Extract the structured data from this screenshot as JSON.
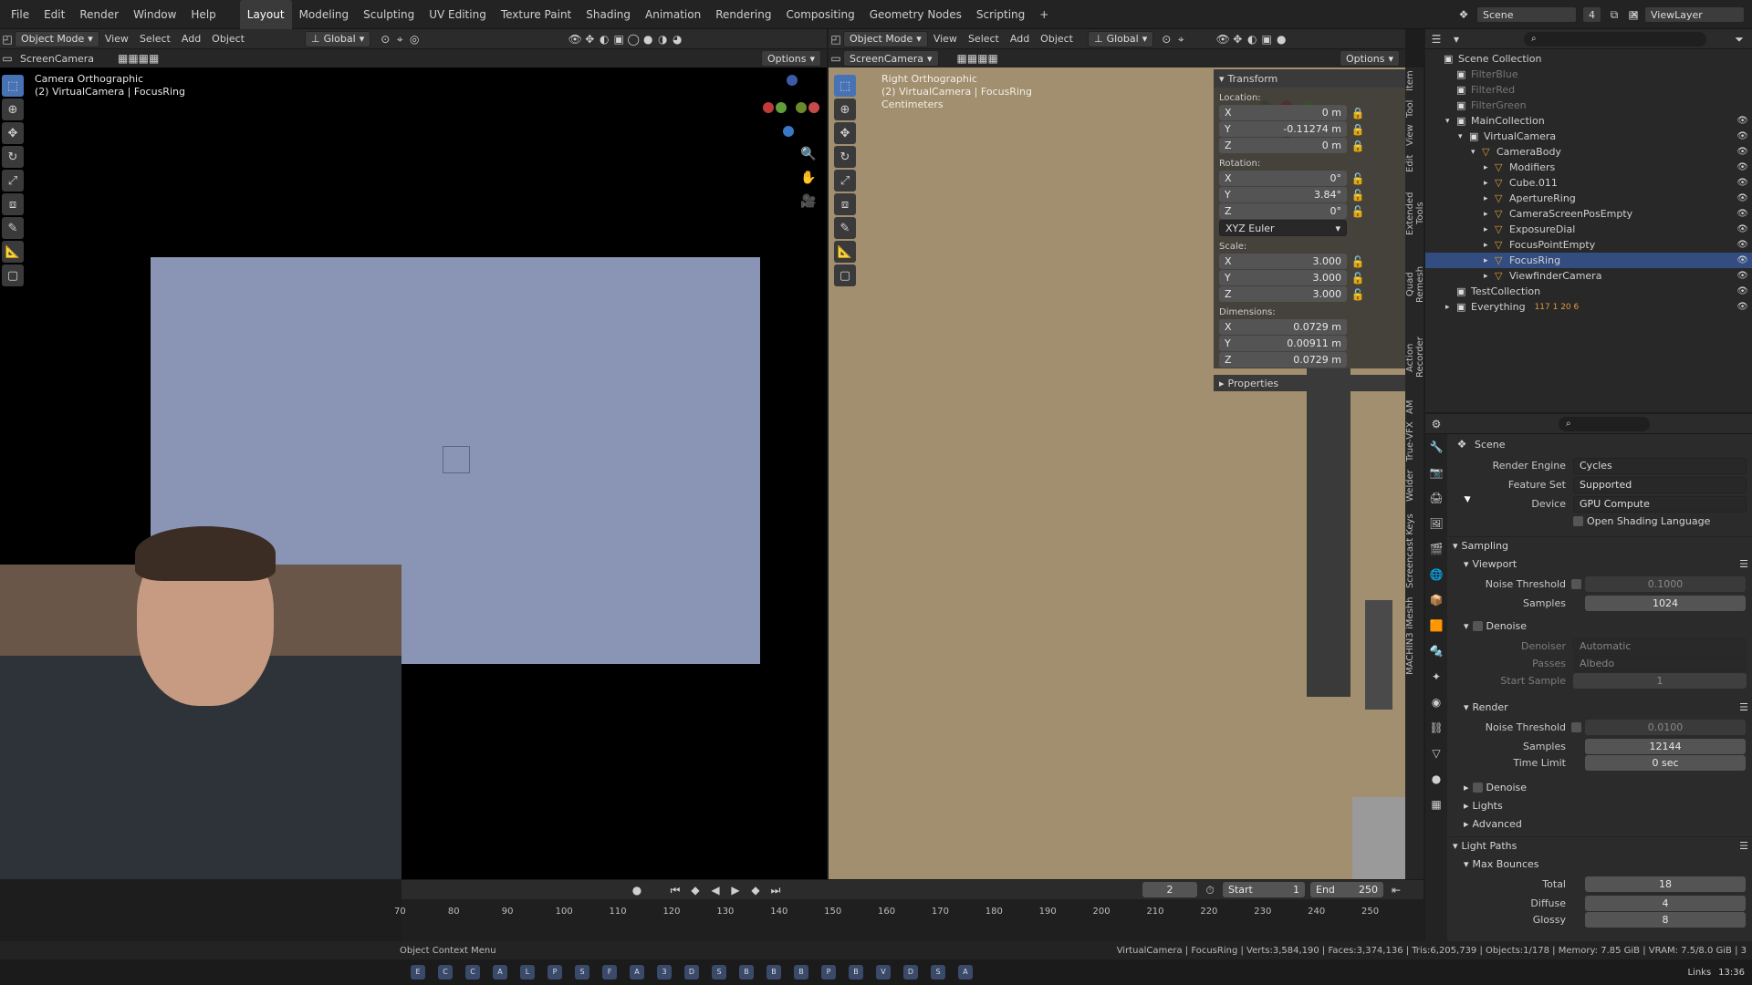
{
  "menubar": {
    "menus": [
      "File",
      "Edit",
      "Render",
      "Window",
      "Help"
    ],
    "workspaces": [
      "Layout",
      "Modeling",
      "Sculpting",
      "UV Editing",
      "Texture Paint",
      "Shading",
      "Animation",
      "Rendering",
      "Compositing",
      "Geometry Nodes",
      "Scripting"
    ],
    "active_workspace": "Layout",
    "add_tab": "+",
    "scene_label": "Scene",
    "scene_num": "4",
    "viewlayer_label": "ViewLayer"
  },
  "left_view": {
    "mode": "Object Mode",
    "menus": [
      "View",
      "Select",
      "Add",
      "Object"
    ],
    "orientation": "Global",
    "options": "Options",
    "camera": "ScreenCamera",
    "overlay_title": "Camera Orthographic",
    "overlay_sub": "(2) VirtualCamera | FocusRing"
  },
  "right_view": {
    "mode": "Object Mode",
    "menus": [
      "View",
      "Select",
      "Add",
      "Object"
    ],
    "orientation": "Global",
    "options": "Options",
    "camera": "ScreenCamera",
    "overlay_title": "Right Orthographic",
    "overlay_sub": "(2) VirtualCamera | FocusRing",
    "overlay_units": "Centimeters"
  },
  "npanel": {
    "transform_title": "Transform",
    "location_label": "Location:",
    "location": {
      "x": "0 m",
      "y": "-0.11274 m",
      "z": "0 m"
    },
    "rotation_label": "Rotation:",
    "rotation": {
      "x": "0°",
      "y": "3.84°",
      "z": "0°"
    },
    "rotation_mode": "XYZ Euler",
    "scale_label": "Scale:",
    "scale": {
      "x": "3.000",
      "y": "3.000",
      "z": "3.000"
    },
    "dimensions_label": "Dimensions:",
    "dimensions": {
      "x": "0.0729 m",
      "y": "0.00911 m",
      "z": "0.0729 m"
    },
    "properties_title": "Properties",
    "tabs": [
      "Item",
      "Tool",
      "View",
      "Edit",
      "Extended Tools",
      "Quad Remesh",
      "Action Recorder",
      "AM",
      "True-VFX",
      "Welder",
      "Screencast Keys",
      "iMeshh",
      "MACHIN3"
    ]
  },
  "outliner": {
    "items": [
      {
        "name": "Scene Collection",
        "indent": 0
      },
      {
        "name": "FilterBlue",
        "indent": 1,
        "dim": true
      },
      {
        "name": "FilterRed",
        "indent": 1,
        "dim": true
      },
      {
        "name": "FilterGreen",
        "indent": 1,
        "dim": true
      },
      {
        "name": "MainCollection",
        "indent": 1
      },
      {
        "name": "VirtualCamera",
        "indent": 2
      },
      {
        "name": "CameraBody",
        "indent": 3
      },
      {
        "name": "Modifiers",
        "indent": 4
      },
      {
        "name": "Cube.011",
        "indent": 4
      },
      {
        "name": "ApertureRing",
        "indent": 4
      },
      {
        "name": "CameraScreenPosEmpty",
        "indent": 4
      },
      {
        "name": "ExposureDial",
        "indent": 4
      },
      {
        "name": "FocusPointEmpty",
        "indent": 4
      },
      {
        "name": "FocusRing",
        "indent": 4,
        "selected": true
      },
      {
        "name": "ViewfinderCamera",
        "indent": 4
      },
      {
        "name": "TestCollection",
        "indent": 1
      },
      {
        "name": "Everything",
        "indent": 1
      }
    ],
    "everything_badges": "117 1 20 6"
  },
  "properties": {
    "context": "Scene",
    "render_engine_label": "Render Engine",
    "render_engine": "Cycles",
    "feature_set_label": "Feature Set",
    "feature_set": "Supported",
    "device_label": "Device",
    "device": "GPU Compute",
    "osl_label": "Open Shading Language",
    "sampling": "Sampling",
    "viewport": "Viewport",
    "noise_threshold_label": "Noise Threshold",
    "vp_noise_threshold": "0.1000",
    "samples_label": "Samples",
    "vp_samples": "1024",
    "denoise": "Denoise",
    "denoiser_label": "Denoiser",
    "denoiser": "Automatic",
    "passes_label": "Passes",
    "passes": "Albedo",
    "start_sample_label": "Start Sample",
    "start_sample": "1",
    "render": "Render",
    "r_noise_threshold": "0.0100",
    "r_samples": "12144",
    "time_limit_label": "Time Limit",
    "time_limit": "0 sec",
    "r_denoise": "Denoise",
    "lights": "Lights",
    "advanced": "Advanced",
    "light_paths": "Light Paths",
    "max_bounces": "Max Bounces",
    "total_label": "Total",
    "total": "18",
    "diffuse_label": "Diffuse",
    "diffuse": "4",
    "glossy_label": "Glossy",
    "glossy": "8"
  },
  "timeline": {
    "current_frame": "2",
    "start_label": "Start",
    "start": "1",
    "end_label": "End",
    "end": "250",
    "ticks": [
      "70",
      "80",
      "90",
      "100",
      "110",
      "120",
      "130",
      "140",
      "150",
      "160",
      "170",
      "180",
      "190",
      "200",
      "210",
      "220",
      "230",
      "240",
      "250"
    ]
  },
  "statusbar": {
    "left": "Object Context Menu",
    "right": "VirtualCamera | FocusRing | Verts:3,584,190 | Faces:3,374,136 | Tris:6,205,739 | Objects:1/178 | Memory: 7.85 GiB | VRAM: 7.5/8.0 GiB | 3"
  },
  "taskbar": {
    "apps": [
      "Explorer",
      "Calculator",
      "Chrome",
      "Affinity",
      "Lr",
      "Ps",
      "Spotify",
      "Firefox",
      "App",
      "3",
      "Ds",
      "Steam",
      "Blender",
      "Blender",
      "Blender",
      "Pt",
      "Blender",
      "VLC",
      "Discord",
      "Sync",
      "Ar"
    ],
    "links": "Links",
    "time": "13:36"
  },
  "colors": {
    "camera_frame": "#8a94b4",
    "right_view_bg": "#a18f6f",
    "selected_row": "#334d80",
    "accent": "#4772b3"
  }
}
